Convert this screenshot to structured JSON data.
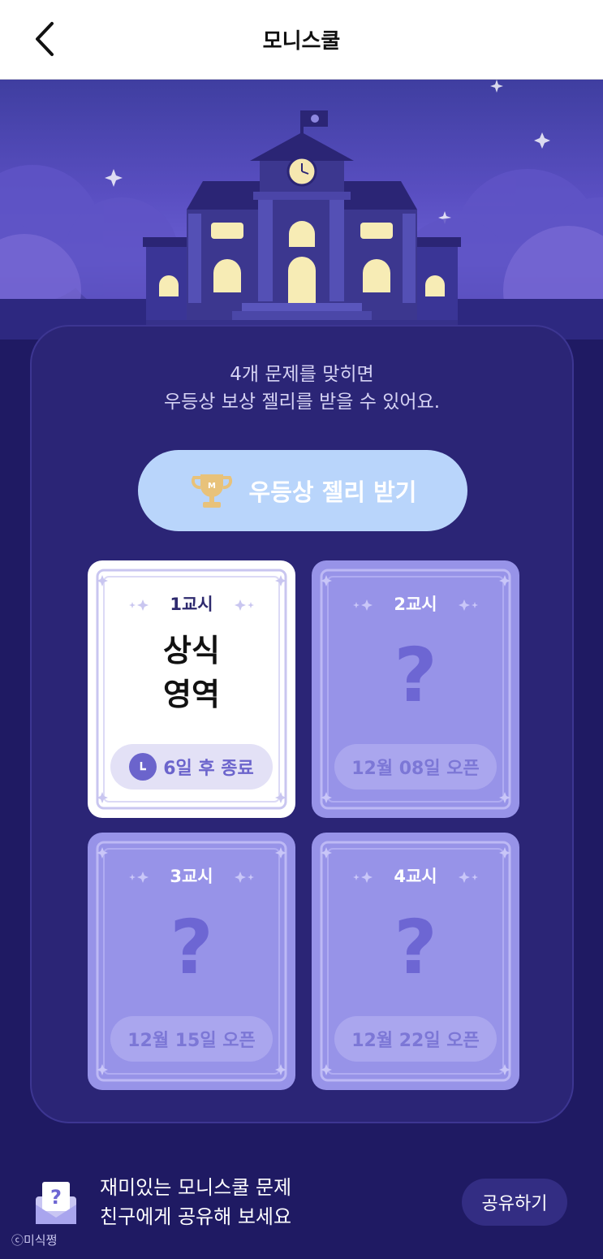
{
  "header": {
    "title": "모니스쿨"
  },
  "intro": {
    "line1": "4개 문제를 맞히면",
    "line2": "우등상 보상 젤리를 받을 수 있어요."
  },
  "reward_button": {
    "label": "우등상 젤리 받기"
  },
  "cards": [
    {
      "period": "1교시",
      "subject_line1": "상식",
      "subject_line2": "영역",
      "status": "6일 후 종료",
      "locked": false
    },
    {
      "period": "2교시",
      "placeholder": "?",
      "status": "12월 08일 오픈",
      "locked": true
    },
    {
      "period": "3교시",
      "placeholder": "?",
      "status": "12월 15일 오픈",
      "locked": true
    },
    {
      "period": "4교시",
      "placeholder": "?",
      "status": "12월 22일 오픈",
      "locked": true
    }
  ],
  "share": {
    "line1": "재미있는 모니스쿨 문제",
    "line2": "친구에게 공유해 보세요",
    "button_label": "공유하기"
  },
  "watermark": "ⓒ미식쩡",
  "colors": {
    "background": "#1f1a63",
    "panel": "#2b2576",
    "card_locked": "#9793e8",
    "reward_button": "#b9d5fb"
  }
}
